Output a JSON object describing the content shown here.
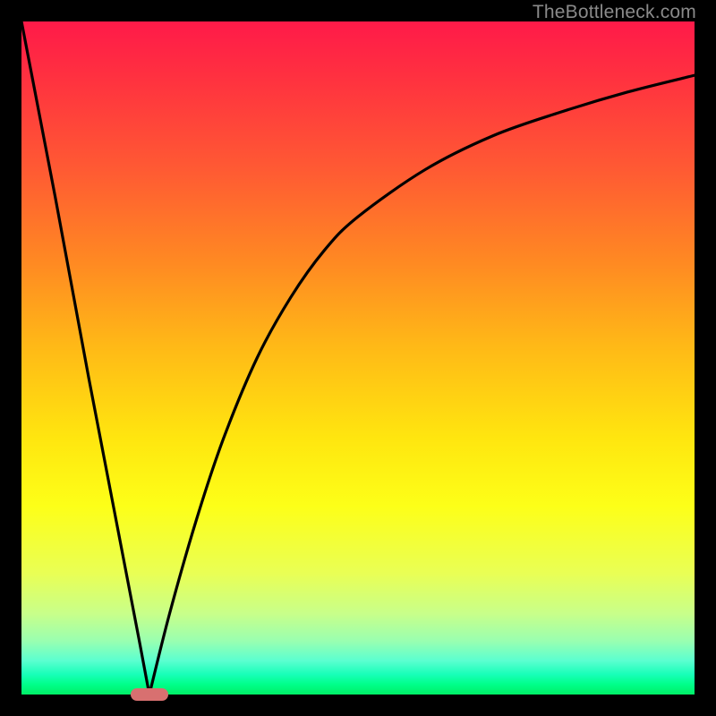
{
  "watermark": {
    "text": "TheBottleneck.com"
  },
  "colors": {
    "frame": "#000000",
    "gradient_top": "#ff1a49",
    "gradient_bottom": "#00ef66",
    "curve": "#000000",
    "marker": "#d87070",
    "watermark": "#8a8a8a"
  },
  "chart_data": {
    "type": "line",
    "title": "",
    "xlabel": "",
    "ylabel": "",
    "xlim": [
      0,
      100
    ],
    "ylim": [
      0,
      100
    ],
    "grid": false,
    "legend": false,
    "description": "V-shaped bottleneck curve on a vertical red-to-green gradient; minimum hits zero around x≈19 (marked with a pink pill), left branch is a steep straight line from (0,100) down to the minimum, right branch rises as a concave curve asymptoting near y≈92 at x=100.",
    "series": [
      {
        "name": "left-branch",
        "x": [
          0,
          5,
          10,
          15,
          17.5,
          19
        ],
        "y": [
          100,
          74,
          47,
          21,
          8,
          0
        ]
      },
      {
        "name": "right-branch",
        "x": [
          19,
          22,
          26,
          30,
          35,
          40,
          45,
          50,
          60,
          70,
          80,
          90,
          100
        ],
        "y": [
          0,
          12,
          26,
          38,
          50,
          59,
          66,
          71,
          78,
          83,
          86.5,
          89.5,
          92
        ]
      }
    ],
    "marker": {
      "x_center": 19,
      "x_halfwidth": 2.8,
      "y": 0,
      "shape": "rounded-pill"
    }
  }
}
